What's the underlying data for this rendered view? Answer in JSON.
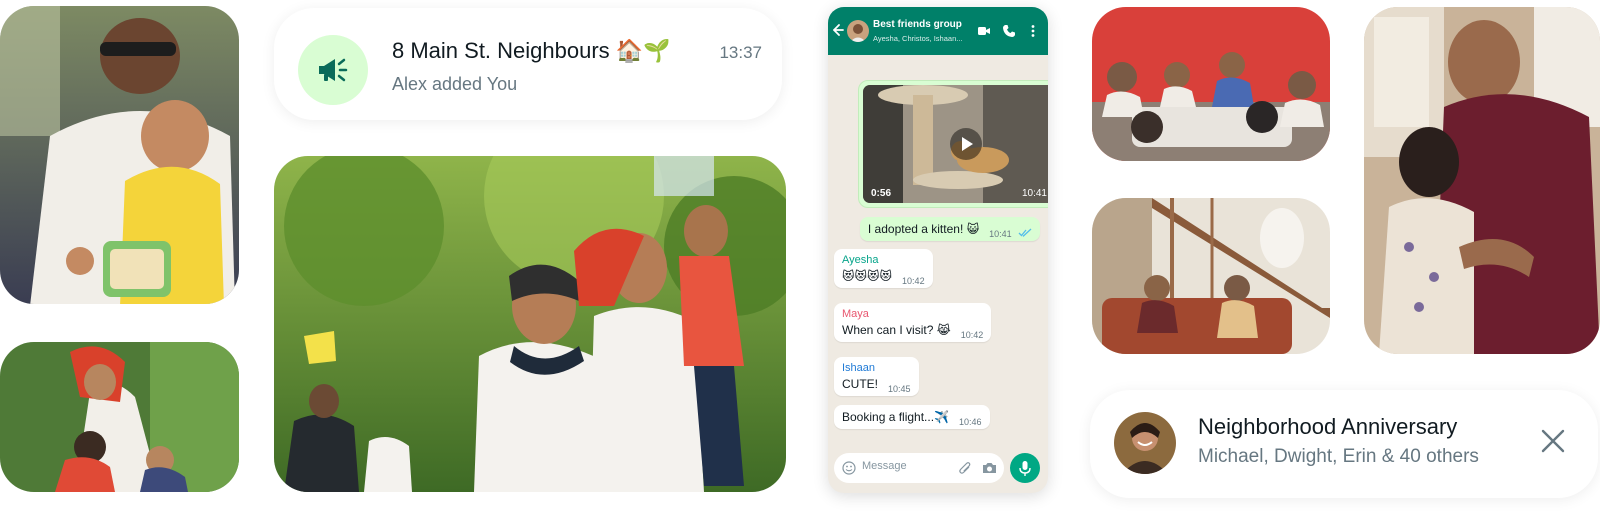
{
  "notification_group": {
    "title": "8 Main St. Neighbours 🏠🌱",
    "subtitle": "Alex added You",
    "time": "13:37",
    "icon": "megaphone-icon"
  },
  "chat": {
    "group_name": "Best friends group",
    "members": "Ayesha, Christos, Ishaan...",
    "header_icons": [
      "back-arrow-icon",
      "video-call-icon",
      "phone-icon",
      "more-vert-icon"
    ],
    "video_message": {
      "duration": "0:56",
      "time": "10:41"
    },
    "messages": [
      {
        "direction": "out",
        "sender": "",
        "text": "I adopted a kitten! 😺",
        "time": "10:41"
      },
      {
        "direction": "in",
        "sender": "Ayesha",
        "text": "😻😻😻😻",
        "time": "10:42"
      },
      {
        "direction": "in",
        "sender": "Maya",
        "text": "When can I visit? 😹",
        "time": "10:42"
      },
      {
        "direction": "in",
        "sender": "Ishaan",
        "text": "CUTE!",
        "time": "10:45"
      },
      {
        "direction": "in",
        "sender": "",
        "text": "Booking a flight...✈️",
        "time": "10:46"
      }
    ],
    "composer_placeholder": "Message",
    "sender_colors": {
      "Ayesha": "#06a48a",
      "Maya": "#e8566f",
      "Ishaan": "#1f7ad6"
    }
  },
  "notification_event": {
    "title": "Neighborhood Anniversary",
    "subtitle": "Michael, Dwight, Erin & 40 others",
    "icon": "close-icon"
  },
  "colors": {
    "brand_green": "#008069",
    "accent_green": "#00a884",
    "bubble_out": "#d9fdd3",
    "chat_bg": "#efeae2",
    "read_ticks": "#53bdeb"
  }
}
